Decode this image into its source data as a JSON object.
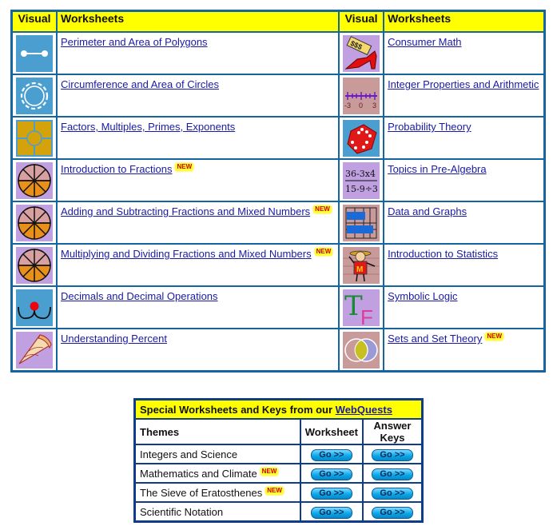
{
  "main_table": {
    "headers": {
      "visual": "Visual",
      "worksheets": "Worksheets"
    },
    "left": [
      {
        "label": "Perimeter and Area of Polygons",
        "icon": "line-segment-icon",
        "new": false
      },
      {
        "label": "Circumference and Area of Circles",
        "icon": "circle-icon",
        "new": false
      },
      {
        "label": "Factors, Multiples, Primes, Exponents",
        "icon": "factor-grid-icon",
        "new": false
      },
      {
        "label": "Introduction to Fractions",
        "icon": "fraction-pie-icon",
        "new": true
      },
      {
        "label": "Adding and Subtracting Fractions and Mixed Numbers",
        "icon": "fraction-pie-icon",
        "new": true
      },
      {
        "label": "Multiplying and Dividing Fractions and Mixed Numbers",
        "icon": "fraction-pie-icon",
        "new": true
      },
      {
        "label": "Decimals and Decimal Operations",
        "icon": "decimal-point-icon",
        "new": false
      },
      {
        "label": "Understanding Percent",
        "icon": "pie-slice-icon",
        "new": false
      }
    ],
    "right": [
      {
        "label": "Consumer Math",
        "icon": "shoe-price-tag-icon",
        "new": false
      },
      {
        "label": "Integer Properties and Arithmetic",
        "icon": "number-line-icon",
        "new": false
      },
      {
        "label": "Probability Theory",
        "icon": "dice-icon",
        "new": false
      },
      {
        "label": "Topics in Pre-Algebra",
        "icon": "expression-icon",
        "new": false
      },
      {
        "label": "Data and Graphs",
        "icon": "bar-graph-icon",
        "new": false
      },
      {
        "label": "Introduction to Statistics",
        "icon": "statistics-character-icon",
        "new": false
      },
      {
        "label": "Symbolic Logic",
        "icon": "true-false-icon",
        "new": false
      },
      {
        "label": "Sets and Set Theory",
        "icon": "venn-diagram-icon",
        "new": true
      }
    ],
    "number_line": {
      "left": "-3",
      "mid": "0",
      "right": "3"
    },
    "expression": {
      "top": "36-3x4",
      "bottom": "15-9÷3"
    },
    "stats_letter": "M",
    "logic_letters": {
      "t": "T",
      "f": "F"
    },
    "price_tag": "$$$"
  },
  "new_badge": "NEW",
  "webquests": {
    "title_prefix": "Special Worksheets and Keys from our ",
    "title_link": "WebQuests",
    "headers": {
      "themes": "Themes",
      "worksheet": "Worksheet",
      "keys": "Answer Keys"
    },
    "rows": [
      {
        "theme": "Integers and Science",
        "new": false
      },
      {
        "theme": "Mathematics and Climate",
        "new": true
      },
      {
        "theme": "The Sieve of Eratosthenes",
        "new": true
      },
      {
        "theme": "Scientific Notation",
        "new": false
      }
    ],
    "button_label": "Go >>"
  },
  "colors": {
    "header_bg": "#ffff00",
    "border": "#1565a0",
    "link": "#1a1aa6"
  }
}
